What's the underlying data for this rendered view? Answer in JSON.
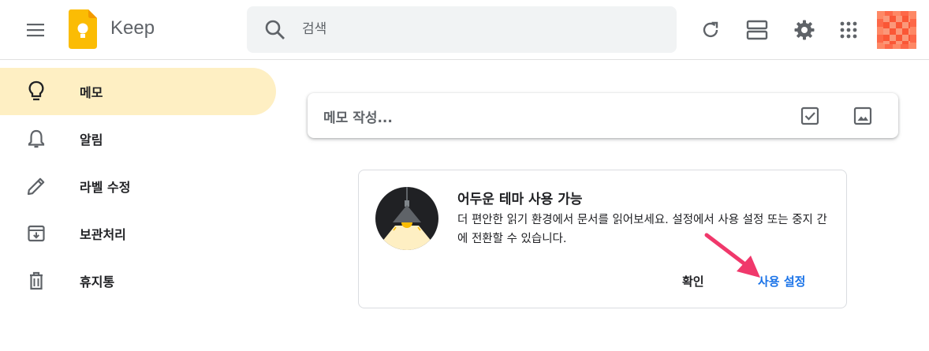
{
  "header": {
    "app_title": "Keep",
    "search_placeholder": "검색",
    "icons": [
      "menu-icon",
      "keep-logo",
      "search-icon",
      "refresh-icon",
      "list-view-icon",
      "settings-icon",
      "apps-icon",
      "avatar"
    ]
  },
  "sidebar": {
    "items": [
      {
        "label": "메모",
        "icon": "lightbulb-icon",
        "active": true
      },
      {
        "label": "알림",
        "icon": "bell-icon",
        "active": false
      },
      {
        "label": "라벨 수정",
        "icon": "pencil-icon",
        "active": false
      },
      {
        "label": "보관처리",
        "icon": "archive-icon",
        "active": false
      },
      {
        "label": "휴지통",
        "icon": "trash-icon",
        "active": false
      }
    ]
  },
  "note_input": {
    "placeholder": "메모 작성...",
    "icons": [
      "checkbox-icon",
      "image-icon"
    ]
  },
  "promo": {
    "title": "어두운 테마 사용 가능",
    "body": "더 편안한 읽기 환경에서 문서를 읽어보세요. 설정에서 사용 설정 또는 중지 간에 전환할 수 있습니다.",
    "confirm_label": "확인",
    "enable_label": "사용 설정"
  },
  "colors": {
    "accent_blue": "#1a73e8",
    "active_nav_bg": "#feefc3",
    "keep_yellow": "#fbbc04",
    "annotation_arrow": "#f0386b"
  }
}
